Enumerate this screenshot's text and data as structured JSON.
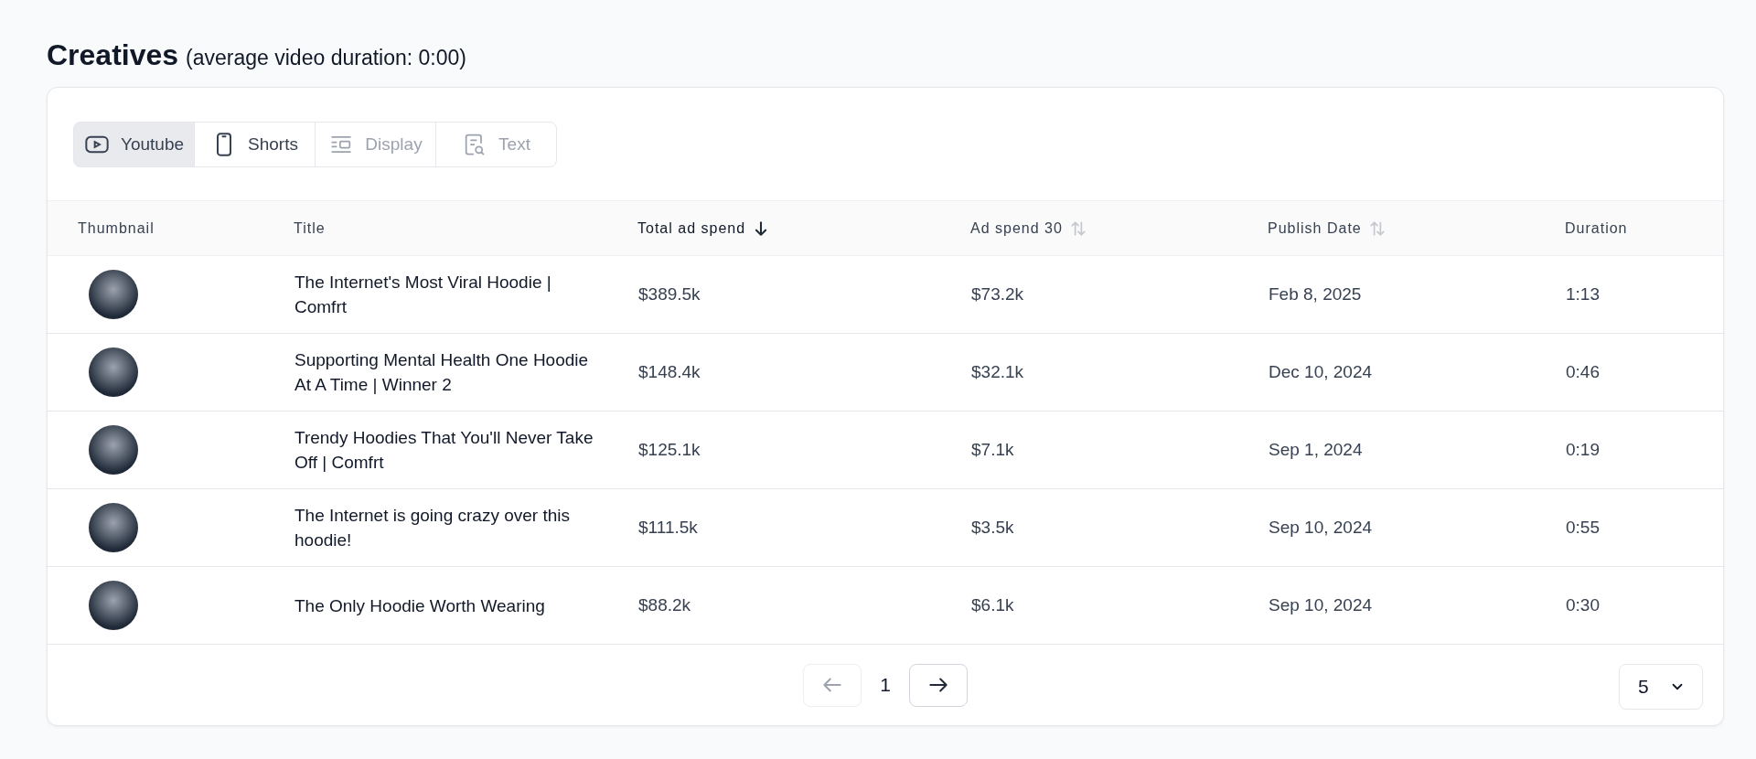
{
  "heading": {
    "title": "Creatives",
    "subtitle": "(average video duration: 0:00)"
  },
  "tabs": [
    {
      "label": "Youtube",
      "kind": "video",
      "selected": true,
      "disabled": false
    },
    {
      "label": "Shorts",
      "kind": "phone",
      "selected": false,
      "disabled": false
    },
    {
      "label": "Display",
      "kind": "display",
      "selected": false,
      "disabled": true
    },
    {
      "label": "Text",
      "kind": "text",
      "selected": false,
      "disabled": true
    }
  ],
  "table": {
    "columns": [
      {
        "label": "Thumbnail"
      },
      {
        "label": "Title"
      },
      {
        "label": "Total ad spend",
        "sorted": true
      },
      {
        "label": "Ad spend 30",
        "sorted": false
      },
      {
        "label": "Publish Date",
        "sorted": false
      },
      {
        "label": "Duration"
      }
    ],
    "rows": [
      {
        "title": "The Internet's Most Viral Hoodie | Comfrt",
        "total": "$389.5k",
        "spend30": "$73.2k",
        "date": "Feb 8, 2025",
        "duration": "1:13"
      },
      {
        "title": "Supporting Mental Health One Hoodie At A Time | Winner 2",
        "total": "$148.4k",
        "spend30": "$32.1k",
        "date": "Dec 10, 2024",
        "duration": "0:46"
      },
      {
        "title": "Trendy Hoodies That You'll Never Take Off | Comfrt",
        "total": "$125.1k",
        "spend30": "$7.1k",
        "date": "Sep 1, 2024",
        "duration": "0:19"
      },
      {
        "title": "The Internet is going crazy over this hoodie!",
        "total": "$111.5k",
        "spend30": "$3.5k",
        "date": "Sep 10, 2024",
        "duration": "0:55"
      },
      {
        "title": "The Only Hoodie Worth Wearing",
        "total": "$88.2k",
        "spend30": "$6.1k",
        "date": "Sep 10, 2024",
        "duration": "0:30"
      }
    ]
  },
  "pagination": {
    "prev_disabled": true,
    "next_disabled": false,
    "page": "1",
    "page_size": "5"
  }
}
